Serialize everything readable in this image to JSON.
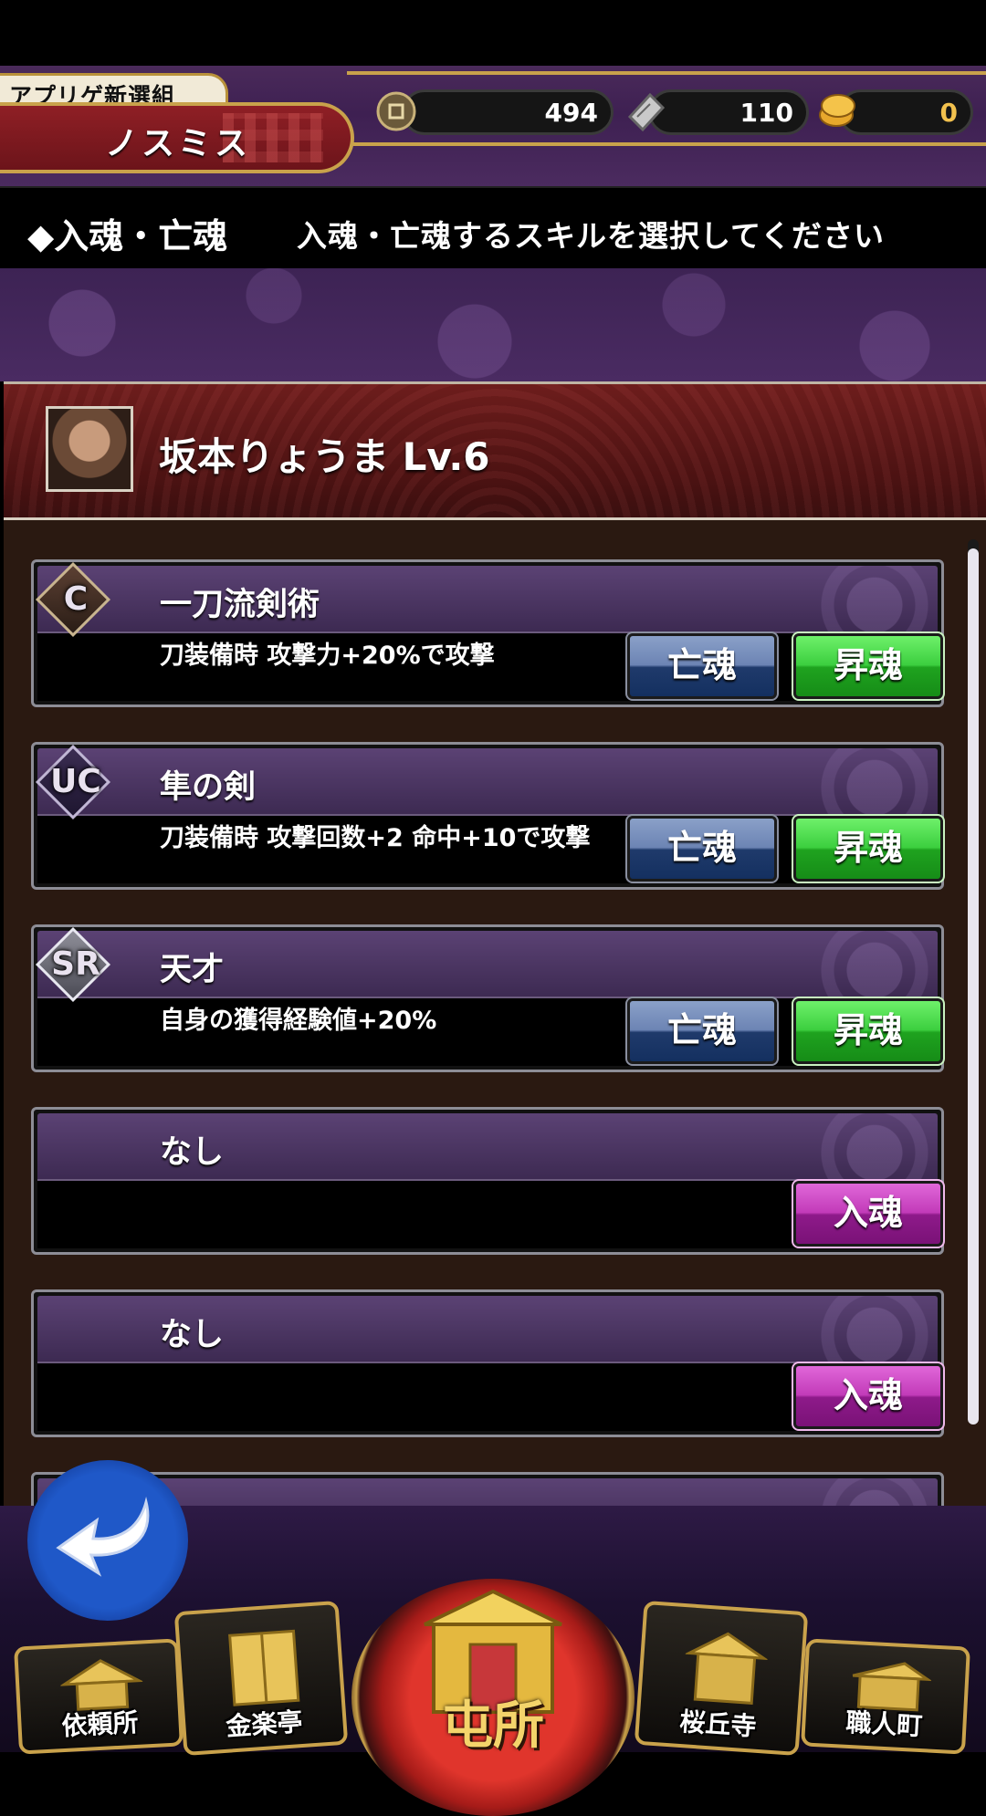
{
  "header": {
    "clan_name": "アプリゲ新選組",
    "player_name": "ノスミス",
    "currencies": [
      {
        "icon": "coin-icon",
        "value": "494"
      },
      {
        "icon": "ticket-icon",
        "value": "110"
      },
      {
        "icon": "gold-koban-icon",
        "value": "0"
      }
    ]
  },
  "banner": {
    "title": "◆入魂・亡魂",
    "instruction": "入魂・亡魂するスキルを選択してください"
  },
  "character": {
    "name": "坂本りょうま Lv.6"
  },
  "skills": [
    {
      "rarity": "C",
      "name": "一刀流剣術",
      "desc": "刀装備時 攻撃力+20%で攻撃",
      "down_label": "亡魂",
      "up_label": "昇魂"
    },
    {
      "rarity": "UC",
      "name": "隼の剣",
      "desc": "刀装備時 攻撃回数+2 命中+10で攻撃",
      "down_label": "亡魂",
      "up_label": "昇魂"
    },
    {
      "rarity": "SR",
      "name": "天才",
      "desc": "自身の獲得経験値+20%",
      "down_label": "亡魂",
      "up_label": "昇魂"
    },
    {
      "rarity": "",
      "name": "なし",
      "desc": "",
      "enter_label": "入魂"
    },
    {
      "rarity": "",
      "name": "なし",
      "desc": "",
      "enter_label": "入魂"
    }
  ],
  "nav": {
    "items": [
      {
        "label": "依頼所",
        "icon": "house-icon"
      },
      {
        "label": "金楽亭",
        "icon": "door-icon"
      },
      {
        "label": "屯所",
        "icon": "hq-building-icon"
      },
      {
        "label": "桜丘寺",
        "icon": "temple-icon"
      },
      {
        "label": "職人町",
        "icon": "workshop-icon"
      }
    ]
  },
  "colors": {
    "accent_gold": "#c9a24b",
    "purple": "#3d2354",
    "button_down": "#1f3a6b",
    "button_up": "#1fa31f",
    "button_enter": "#8e1a8a"
  }
}
